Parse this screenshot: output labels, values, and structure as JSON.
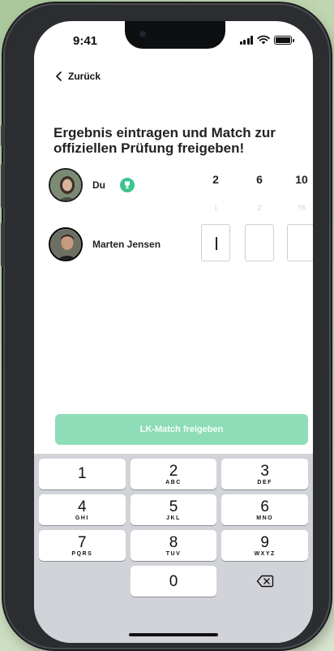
{
  "status_bar": {
    "time": "9:41"
  },
  "nav": {
    "back_label": "Zurück"
  },
  "title": "Ergebnis eintragen und Match zur offiziellen Prüfung freigeben!",
  "players": [
    {
      "name": "Du",
      "scores": [
        "2",
        "6",
        "10"
      ]
    },
    {
      "name": "Marten Jensen"
    }
  ],
  "set_labels": [
    "1",
    "2",
    "TB"
  ],
  "cta": {
    "label": "LK-Match freigeben"
  },
  "keyboard": {
    "rows": [
      [
        {
          "num": "1",
          "letters": ""
        },
        {
          "num": "2",
          "letters": "ABC"
        },
        {
          "num": "3",
          "letters": "DEF"
        }
      ],
      [
        {
          "num": "4",
          "letters": "GHI"
        },
        {
          "num": "5",
          "letters": "JKL"
        },
        {
          "num": "6",
          "letters": "MNO"
        }
      ],
      [
        {
          "num": "7",
          "letters": "PQRS"
        },
        {
          "num": "8",
          "letters": "TUV"
        },
        {
          "num": "9",
          "letters": "WXYZ"
        }
      ]
    ],
    "zero": "0"
  },
  "colors": {
    "accent": "#3cc48f",
    "cta_disabled": "#8fdcb9",
    "keyboard_bg": "#d1d3d9"
  }
}
